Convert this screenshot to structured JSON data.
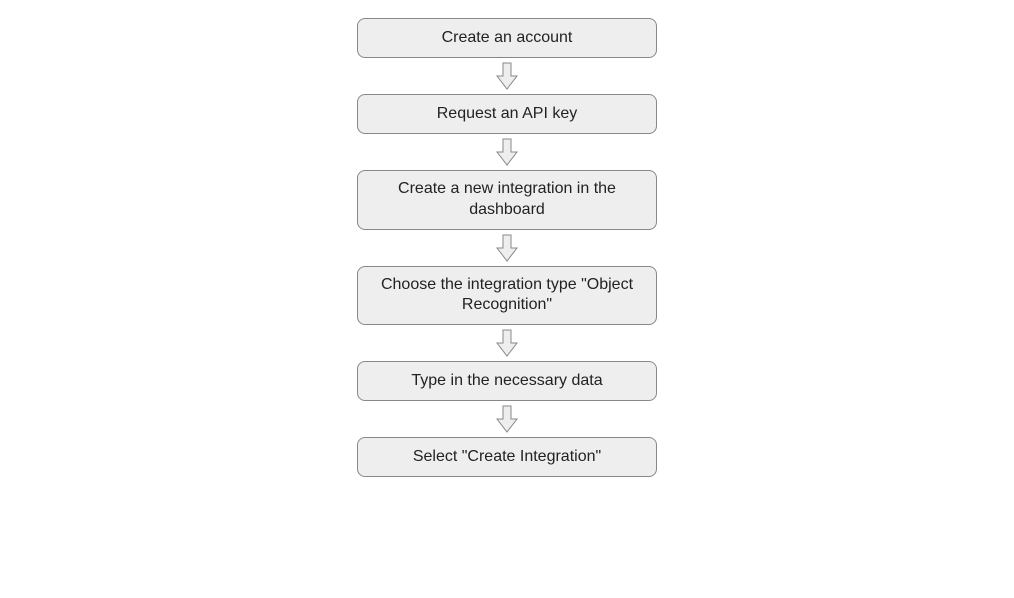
{
  "flow": {
    "steps": [
      {
        "label": "Create an account",
        "tall": false
      },
      {
        "label": "Request an API key",
        "tall": false
      },
      {
        "label": "Create a new integration in the dashboard",
        "tall": true
      },
      {
        "label": "Choose the integration type \"Object Recognition\"",
        "tall": true
      },
      {
        "label": "Type in the necessary data",
        "tall": false
      },
      {
        "label": "Select \"Create Integration\"",
        "tall": false
      }
    ]
  },
  "styles": {
    "box_fill": "#eeeeee",
    "box_stroke": "#888888",
    "arrow_fill": "#eeeeee",
    "arrow_stroke": "#888888"
  }
}
